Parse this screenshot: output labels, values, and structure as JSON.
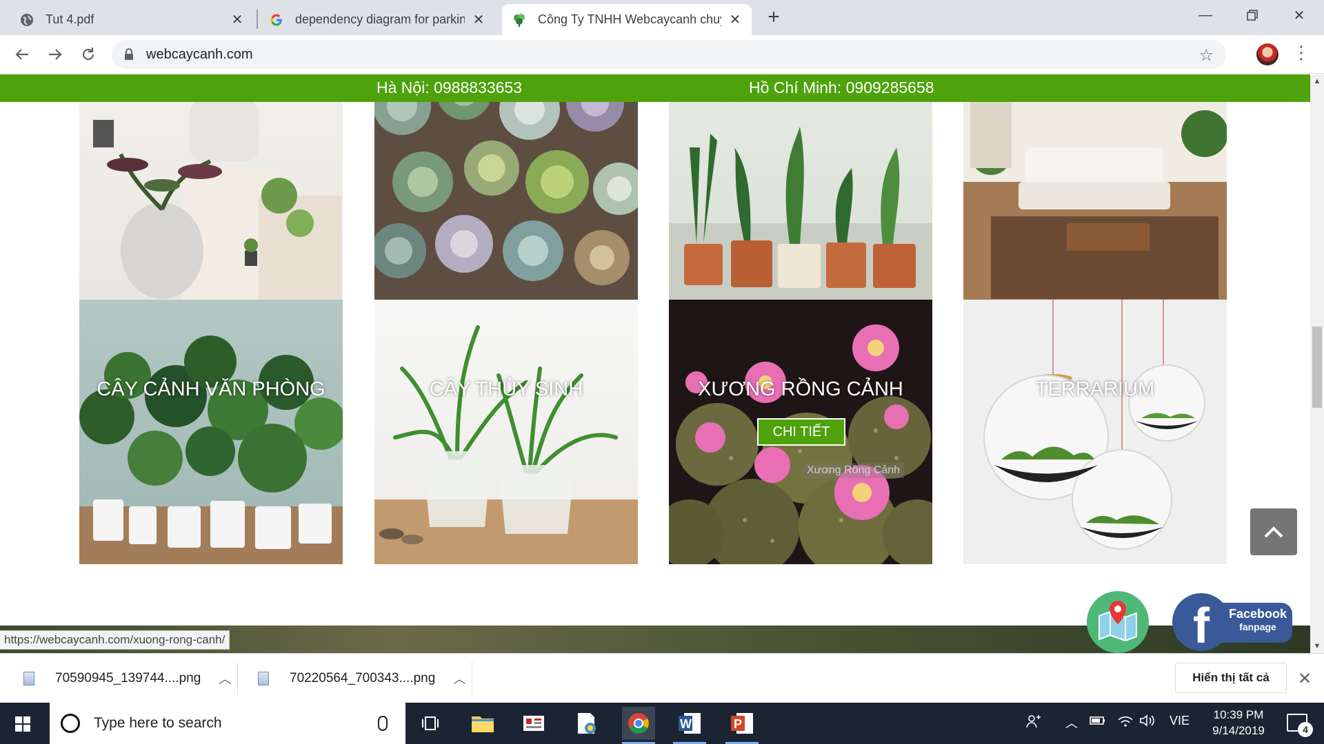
{
  "browser": {
    "tabs": [
      {
        "title": "Tut 4.pdf",
        "icon": "globe-icon",
        "active": false
      },
      {
        "title": "dependency diagram for parking",
        "icon": "google-icon",
        "active": false
      },
      {
        "title": "Công Ty TNHH Webcaycanh chuy",
        "icon": "leaf-favicon-icon",
        "active": true
      }
    ],
    "new_tab_label": "+",
    "url": "webcaycanh.com"
  },
  "page": {
    "topbar": {
      "hanoi": "Hà Nội: 0988833653",
      "hcm": "Hồ Chí Minh: 0909285658",
      "color": "#4ea20c"
    },
    "categories_row2": [
      {
        "label": "CÂY CẢNH VĂN PHÒNG"
      },
      {
        "label": "CÂY THỦY SINH"
      },
      {
        "label": "XƯƠNG RỒNG CẢNH",
        "button": "CHI TIẾT",
        "tooltip": "Xương Rồng Cảnh"
      },
      {
        "label": "TERRARIUM"
      }
    ],
    "status_url": "https://webcaycanh.com/xuong-rong-canh/",
    "facebook": {
      "line1": "Facebook",
      "line2": "fanpage"
    }
  },
  "downloads": {
    "items": [
      {
        "name": "70590945_139744....png"
      },
      {
        "name": "70220564_700343....png"
      }
    ],
    "show_all": "Hiển thị tất cả"
  },
  "taskbar": {
    "search_placeholder": "Type here to search",
    "language": "VIE",
    "time": "10:39 PM",
    "date": "9/14/2019",
    "notification_count": "4"
  }
}
